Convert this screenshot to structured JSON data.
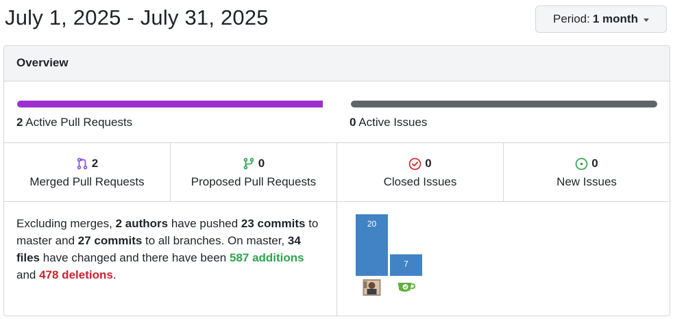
{
  "header": {
    "title": "July 1, 2025 - July 31, 2025",
    "period_prefix": "Period:",
    "period_value": "1 month"
  },
  "overview": {
    "title": "Overview",
    "pull_requests": {
      "count": "2",
      "label": "Active Pull Requests",
      "fill": 1.0,
      "color": "#9c2fcf"
    },
    "issues": {
      "count": "0",
      "label": "Active Issues",
      "fill": 1.0,
      "color": "#5f6469"
    }
  },
  "stats": [
    {
      "icon": "git-merge-icon",
      "count": "2",
      "label": "Merged Pull Requests",
      "color": "#8250df"
    },
    {
      "icon": "git-pull-request-icon",
      "count": "0",
      "label": "Proposed Pull Requests",
      "color": "#2da44e"
    },
    {
      "icon": "issue-closed-icon",
      "count": "0",
      "label": "Closed Issues",
      "color": "#cf222e"
    },
    {
      "icon": "issue-opened-icon",
      "count": "0",
      "label": "New Issues",
      "color": "#2da44e"
    }
  ],
  "summary": {
    "s1": "Excluding merges, ",
    "authors": "2 authors",
    "s2": " have pushed ",
    "commits_master": "23 commits",
    "s3": " to master and ",
    "commits_all": "27 commits",
    "s4": " to all branches. On master, ",
    "files": "34 files",
    "s5": " have changed and there have been ",
    "additions": "587 additions",
    "s6": " and ",
    "deletions": "478 deletions",
    "s7": "."
  },
  "chart_data": {
    "type": "bar",
    "categories": [
      "",
      ""
    ],
    "values": [
      20,
      7
    ],
    "title": "",
    "xlabel": "",
    "ylabel": "",
    "ylim": [
      0,
      20
    ],
    "bar_color": "#4183c4",
    "author_icons": [
      "avatar-photo",
      "tea-cup-logo"
    ]
  }
}
